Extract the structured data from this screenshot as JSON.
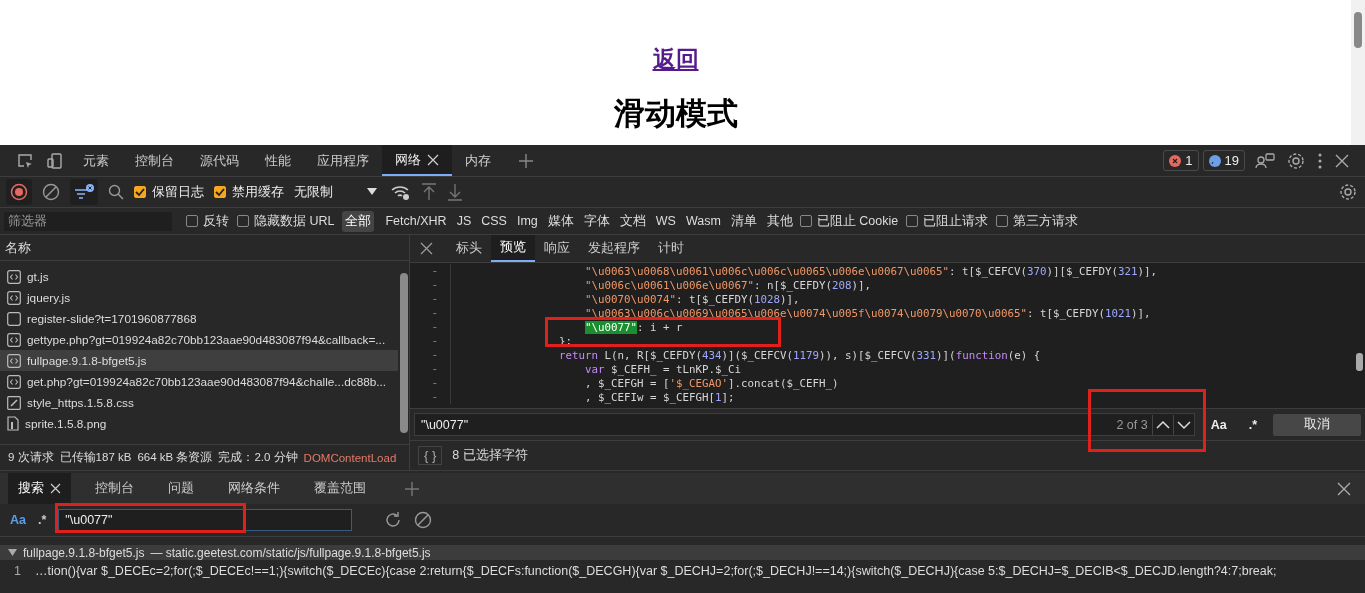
{
  "page": {
    "back_link": "返回",
    "heading": "滑动模式"
  },
  "devtools": {
    "main_tabs": [
      {
        "label": "元素",
        "selected": false
      },
      {
        "label": "控制台",
        "selected": false
      },
      {
        "label": "源代码",
        "selected": false
      },
      {
        "label": "性能",
        "selected": false
      },
      {
        "label": "应用程序",
        "selected": false
      },
      {
        "label": "网络",
        "selected": true
      },
      {
        "label": "内存",
        "selected": false
      }
    ],
    "error_count": "1",
    "message_count": "19",
    "toolbar": {
      "preserve_log": {
        "label": "保留日志",
        "checked": true
      },
      "disable_cache": {
        "label": "禁用缓存",
        "checked": true
      },
      "throttle": "无限制"
    },
    "filter": {
      "placeholder": "筛选器",
      "options": [
        {
          "label": "反转",
          "checked": false
        },
        {
          "label": "隐藏数据 URL",
          "checked": false
        }
      ],
      "types": [
        {
          "label": "全部",
          "selected": true
        },
        {
          "label": "Fetch/XHR",
          "selected": false
        },
        {
          "label": "JS",
          "selected": false
        },
        {
          "label": "CSS",
          "selected": false
        },
        {
          "label": "Img",
          "selected": false
        },
        {
          "label": "媒体",
          "selected": false
        },
        {
          "label": "字体",
          "selected": false
        },
        {
          "label": "文档",
          "selected": false
        },
        {
          "label": "WS",
          "selected": false
        },
        {
          "label": "Wasm",
          "selected": false
        },
        {
          "label": "清单",
          "selected": false
        },
        {
          "label": "其他",
          "selected": false
        }
      ],
      "blocks": [
        {
          "label": "已阻止 Cookie",
          "checked": false
        },
        {
          "label": "已阻止请求",
          "checked": false
        },
        {
          "label": "第三方请求",
          "checked": false
        }
      ]
    },
    "requests": {
      "column": "名称",
      "rows": [
        {
          "name": "gt.js",
          "kind": "script",
          "selected": false
        },
        {
          "name": "jquery.js",
          "kind": "script",
          "selected": false
        },
        {
          "name": "register-slide?t=1701960877868",
          "kind": "document",
          "selected": false
        },
        {
          "name": "gettype.php?gt=019924a82c70bb123aae90d483087f94&callback=...",
          "kind": "script",
          "selected": false
        },
        {
          "name": "fullpage.9.1.8-bfget5.js",
          "kind": "script",
          "selected": true
        },
        {
          "name": "get.php?gt=019924a82c70bb123aae90d483087f94&challe...dc88b...",
          "kind": "script",
          "selected": false
        },
        {
          "name": "style_https.1.5.8.css",
          "kind": "stylesheet",
          "selected": false
        },
        {
          "name": "sprite.1.5.8.png",
          "kind": "image",
          "selected": false
        }
      ]
    },
    "summary": [
      {
        "text": "9 次请求",
        "kind": "plain"
      },
      {
        "text": "已传输187 kB",
        "kind": "plain"
      },
      {
        "text": "664 kB 条资源",
        "kind": "plain"
      },
      {
        "text": "完成：2.0 分钟",
        "kind": "plain"
      },
      {
        "text": "DOMContentLoad",
        "kind": "event"
      }
    ],
    "detail_tabs": [
      {
        "label": "标头",
        "selected": false
      },
      {
        "label": "预览",
        "selected": true
      },
      {
        "label": "响应",
        "selected": false
      },
      {
        "label": "发起程序",
        "selected": false
      },
      {
        "label": "计时",
        "selected": false
      }
    ],
    "code_lines": [
      {
        "gutter": "-",
        "tokens": [
          {
            "kind": "string",
            "text": "                    \"\\u0063\\u0068\\u0061\\u006c\\u006c\\u0065\\u006e\\u0067\\u0065\""
          },
          {
            "kind": "plain",
            "text": ": t[$_CEFCV("
          },
          {
            "kind": "number",
            "text": "370"
          },
          {
            "kind": "plain",
            "text": ")][$_CEFDY("
          },
          {
            "kind": "number",
            "text": "321"
          },
          {
            "kind": "plain",
            "text": ")],"
          }
        ]
      },
      {
        "gutter": "-",
        "tokens": [
          {
            "kind": "string",
            "text": "                    \"\\u006c\\u0061\\u006e\\u0067\""
          },
          {
            "kind": "plain",
            "text": ": n[$_CEFDY("
          },
          {
            "kind": "number",
            "text": "208"
          },
          {
            "kind": "plain",
            "text": ")],"
          }
        ]
      },
      {
        "gutter": "-",
        "tokens": [
          {
            "kind": "string",
            "text": "                    \"\\u0070\\u0074\""
          },
          {
            "kind": "plain",
            "text": ": t[$_CEFDY("
          },
          {
            "kind": "number",
            "text": "1028"
          },
          {
            "kind": "plain",
            "text": ")],"
          }
        ]
      },
      {
        "gutter": "-",
        "tokens": [
          {
            "kind": "string",
            "text": "                    \"\\u0063\\u006c\\u0069\\u0065\\u006e\\u0074\\u005f\\u0074\\u0079\\u0070\\u0065\""
          },
          {
            "kind": "plain",
            "text": ": t[$_CEFDY("
          },
          {
            "kind": "number",
            "text": "1021"
          },
          {
            "kind": "plain",
            "text": ")],"
          }
        ]
      },
      {
        "gutter": "-",
        "tokens": [
          {
            "kind": "indented_match",
            "text": "\"\\u0077\""
          },
          {
            "kind": "plain",
            "text": ": i + r"
          }
        ]
      },
      {
        "gutter": "-",
        "tokens": [
          {
            "kind": "plain",
            "text": "                };"
          }
        ]
      },
      {
        "gutter": "-",
        "tokens": [
          {
            "kind": "keyword",
            "text": "                return"
          },
          {
            "kind": "plain",
            "text": " L(n, R[$_CEFDY("
          },
          {
            "kind": "number",
            "text": "434"
          },
          {
            "kind": "plain",
            "text": ")]($_CEFCV("
          },
          {
            "kind": "number",
            "text": "1179"
          },
          {
            "kind": "plain",
            "text": ")), s)[$_CEFCV("
          },
          {
            "kind": "number",
            "text": "331"
          },
          {
            "kind": "plain",
            "text": ")]("
          },
          {
            "kind": "keyword",
            "text": "function"
          },
          {
            "kind": "plain",
            "text": "(e) {"
          }
        ]
      },
      {
        "gutter": "-",
        "tokens": [
          {
            "kind": "keyword",
            "text": "                    var"
          },
          {
            "kind": "plain",
            "text": " $_CEFH_ = tLnKP.$_Ci"
          }
        ]
      },
      {
        "gutter": "-",
        "tokens": [
          {
            "kind": "plain",
            "text": "                    , $_CEFGH = ["
          },
          {
            "kind": "string",
            "text": "'$_CEGAO'"
          },
          {
            "kind": "plain",
            "text": "].concat($_CEFH_)"
          }
        ]
      },
      {
        "gutter": "-",
        "tokens": [
          {
            "kind": "plain",
            "text": "                    , $_CEFIw = $_CEFGH["
          },
          {
            "kind": "number",
            "text": "1"
          },
          {
            "kind": "plain",
            "text": "];"
          }
        ]
      }
    ],
    "find": {
      "value": "\"\\u0077\"",
      "count": "2 of 3",
      "match_case": "Aa",
      "regex": ".*",
      "cancel": "取消"
    },
    "status": {
      "braces": "{ }",
      "text": "8 已选择字符"
    },
    "drawer": {
      "tabs": [
        {
          "label": "搜索",
          "selected": true
        },
        {
          "label": "控制台",
          "selected": false
        },
        {
          "label": "问题",
          "selected": false
        },
        {
          "label": "网络条件",
          "selected": false
        },
        {
          "label": "覆盖范围",
          "selected": false
        }
      ],
      "match_case": "Aa",
      "regex": ".*",
      "search_value": "\"\\u0077\"",
      "result": {
        "file": "fullpage.9.1.8-bfget5.js",
        "url": "— static.geetest.com/static/js/fullpage.9.1.8-bfget5.js",
        "line_number": "1",
        "text": "…tion(){var $_DECEc=2;for(;$_DECEc!==1;){switch($_DECEc){case 2:return{$_DECFs:function($_DECGH){var $_DECHJ=2;for(;$_DECHJ!==14;){switch($_DECHJ){case 5:$_DECHJ=$_DECIB<$_DECJD.length?4:7;break;"
      }
    }
  }
}
